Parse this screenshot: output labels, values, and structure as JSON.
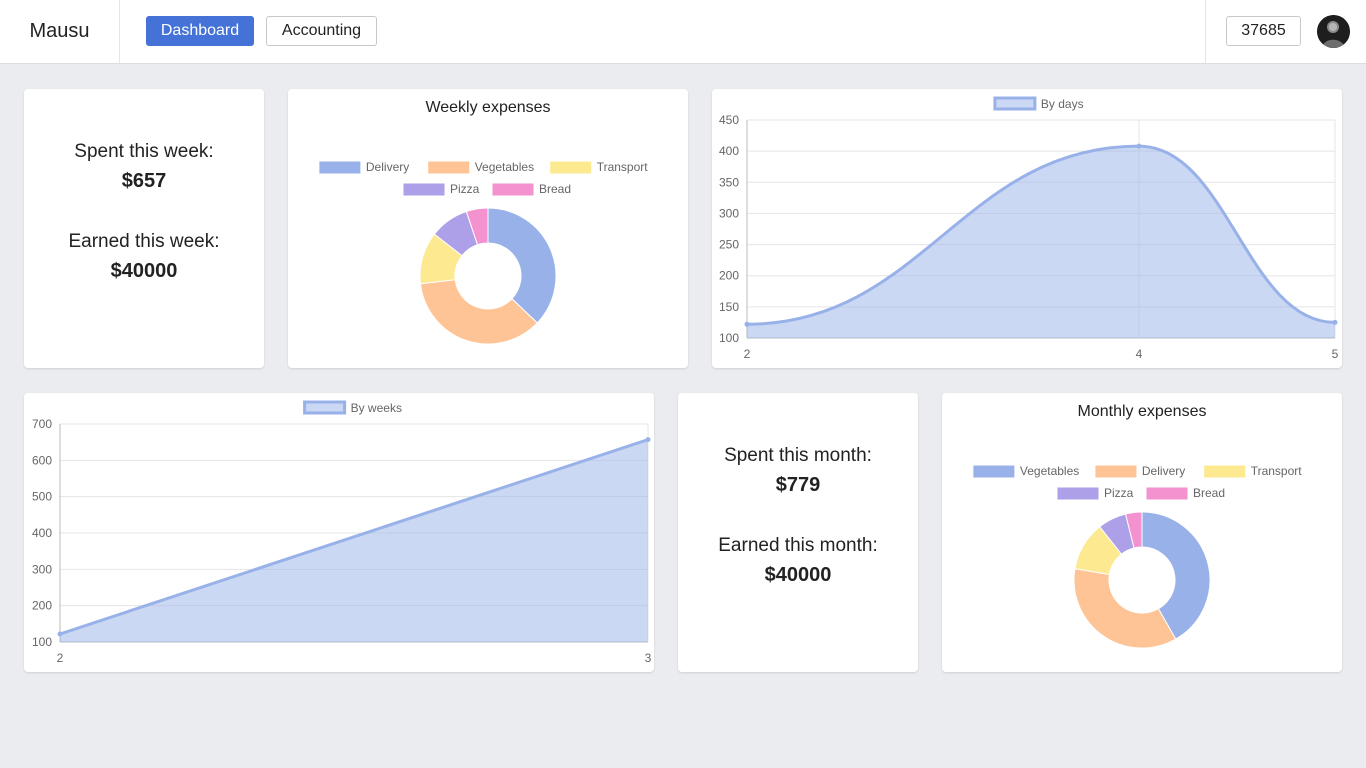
{
  "header": {
    "brand": "Mausu",
    "nav": {
      "dashboard_label": "Dashboard",
      "accounting_label": "Accounting"
    },
    "balance": "37685",
    "accent_color": "#4472d6"
  },
  "weekly_summary": {
    "spent_label": "Spent this week:",
    "spent_value": "$657",
    "earned_label": "Earned this week:",
    "earned_value": "$40000"
  },
  "monthly_summary": {
    "spent_label": "Spent this month:",
    "spent_value": "$779",
    "earned_label": "Earned this month:",
    "earned_value": "$40000"
  },
  "chart_data": [
    {
      "type": "doughnut",
      "title": "Weekly expenses",
      "labels": [
        "Delivery",
        "Vegetables",
        "Transport",
        "Pizza",
        "Bread"
      ],
      "values": [
        36,
        35,
        12,
        9,
        5
      ],
      "colors": [
        "#98b1e8",
        "#fec496",
        "#fde98f",
        "#ad9fe8",
        "#f392cf"
      ]
    },
    {
      "type": "area",
      "title": "",
      "series": [
        {
          "name": "By days",
          "x": [
            2,
            4,
            5
          ],
          "y": [
            122,
            408,
            125
          ]
        }
      ],
      "xlabel": "",
      "ylabel": "",
      "xticks": [
        "2",
        "4",
        "5"
      ],
      "ylim": [
        100,
        450
      ],
      "yticks": [
        100,
        150,
        200,
        250,
        300,
        350,
        400,
        450
      ],
      "grid": true,
      "legend": "top"
    },
    {
      "type": "area",
      "title": "",
      "series": [
        {
          "name": "By weeks",
          "x": [
            2,
            3
          ],
          "y": [
            122,
            657
          ]
        }
      ],
      "xlabel": "",
      "ylabel": "",
      "xticks": [
        "2",
        "3"
      ],
      "ylim": [
        100,
        700
      ],
      "yticks": [
        100,
        200,
        300,
        400,
        500,
        600,
        700
      ],
      "grid": true,
      "legend": "top"
    },
    {
      "type": "doughnut",
      "title": "Monthly expenses",
      "labels": [
        "Vegetables",
        "Delivery",
        "Transport",
        "Pizza",
        "Bread"
      ],
      "values": [
        43,
        37,
        12,
        7,
        4
      ],
      "colors": [
        "#98b1e8",
        "#fec496",
        "#fde98f",
        "#ad9fe8",
        "#f392cf"
      ]
    }
  ]
}
